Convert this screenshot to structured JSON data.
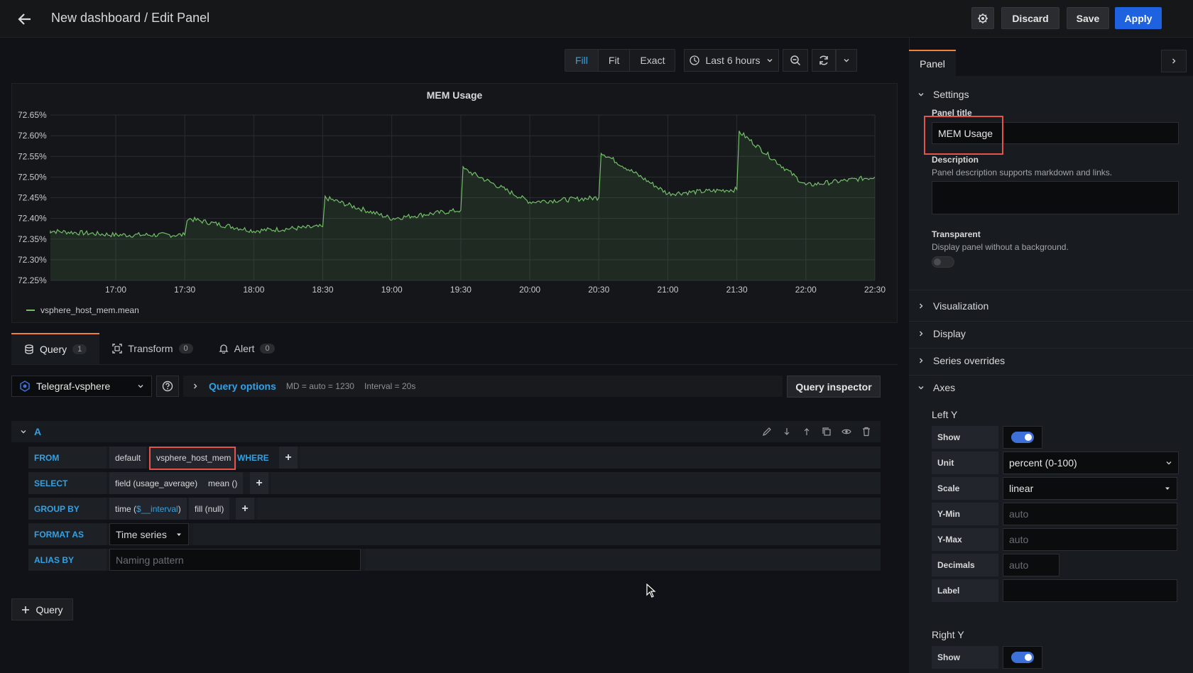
{
  "header": {
    "title": "New dashboard / Edit Panel",
    "discard_label": "Discard",
    "save_label": "Save",
    "apply_label": "Apply"
  },
  "toolbar": {
    "modes": [
      "Fill",
      "Fit",
      "Exact"
    ],
    "active_mode": "Fill",
    "time_range": "Last 6 hours"
  },
  "panel": {
    "title": "MEM Usage",
    "legend": "vsphere_host_mem.mean"
  },
  "chart_data": {
    "type": "area",
    "title": "MEM Usage",
    "y_ticks": [
      "72.65%",
      "72.60%",
      "72.55%",
      "72.50%",
      "72.45%",
      "72.40%",
      "72.35%",
      "72.30%",
      "72.25%"
    ],
    "x_ticks": [
      "17:00",
      "17:30",
      "18:00",
      "18:30",
      "19:00",
      "19:30",
      "20:00",
      "20:30",
      "21:00",
      "21:30",
      "22:00",
      "22:30"
    ],
    "ylim": [
      72.25,
      72.65
    ],
    "series": [
      {
        "name": "vsphere_host_mem.mean",
        "color": "#73bf69",
        "x": [
          "16:30",
          "17:00",
          "17:30",
          "17:31",
          "18:00",
          "18:30",
          "18:31",
          "19:00",
          "19:30",
          "19:31",
          "20:00",
          "20:30",
          "20:31",
          "21:00",
          "21:30",
          "21:31",
          "22:00",
          "22:30"
        ],
        "values": [
          72.37,
          72.36,
          72.36,
          72.4,
          72.37,
          72.38,
          72.45,
          72.4,
          72.42,
          72.52,
          72.44,
          72.45,
          72.56,
          72.46,
          72.47,
          72.61,
          72.48,
          72.5
        ]
      }
    ]
  },
  "tabs": [
    {
      "label": "Query",
      "count": "1"
    },
    {
      "label": "Transform",
      "count": "0"
    },
    {
      "label": "Alert",
      "count": "0"
    }
  ],
  "query_bar": {
    "datasource": "Telegraf-vsphere",
    "options_label": "Query options",
    "md": "MD = auto = 1230",
    "interval": "Interval = 20s",
    "inspector_label": "Query inspector"
  },
  "query": {
    "letter": "A",
    "from_kw": "FROM",
    "policy": "default",
    "measurement": "vsphere_host_mem",
    "where_kw": "WHERE",
    "select_kw": "SELECT",
    "field": "field (usage_average)",
    "agg": "mean ()",
    "groupby_kw": "GROUP BY",
    "time_prefix": "time (",
    "time_var": "$__interval",
    "time_suffix": ")",
    "fill": "fill (null)",
    "format_kw": "FORMAT AS",
    "format_value": "Time series",
    "alias_kw": "ALIAS BY",
    "alias_placeholder": "Naming pattern",
    "add_query_label": "Query"
  },
  "options_pane": {
    "tab": "Panel",
    "settings": "Settings",
    "panel_title_label": "Panel title",
    "panel_title_value": "MEM Usage",
    "description_label": "Description",
    "description_hint": "Panel description supports markdown and links.",
    "transparent_label": "Transparent",
    "transparent_hint": "Display panel without a background.",
    "visualization": "Visualization",
    "display": "Display",
    "series_overrides": "Series overrides",
    "axes": "Axes",
    "left_y": "Left Y",
    "right_y": "Right Y",
    "show_label": "Show",
    "unit_label": "Unit",
    "unit_value": "percent (0-100)",
    "scale_label": "Scale",
    "scale_value": "linear",
    "ymin_label": "Y-Min",
    "ymax_label": "Y-Max",
    "decimals_label": "Decimals",
    "label_label": "Label",
    "auto_placeholder": "auto"
  },
  "colors": {
    "accent": "#33a2e5",
    "primary": "#1f62e0",
    "series": "#73bf69",
    "highlight": "#e5534b"
  }
}
